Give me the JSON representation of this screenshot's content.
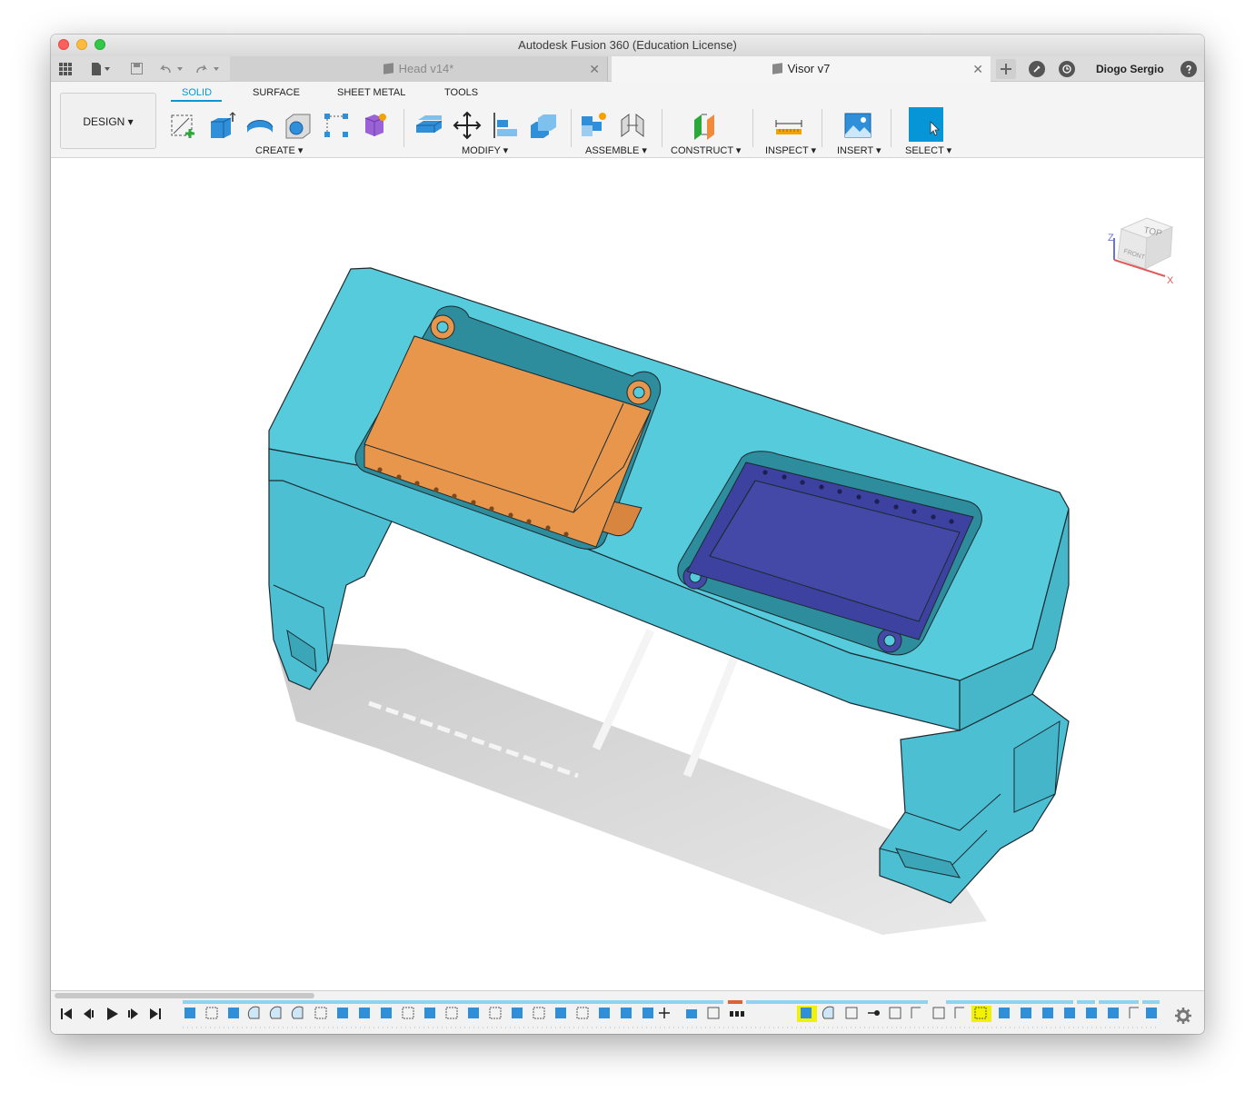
{
  "window": {
    "title": "Autodesk Fusion 360 (Education License)"
  },
  "tabs": [
    {
      "label": "Head v14*",
      "active": false
    },
    {
      "label": "Visor v7",
      "active": true
    }
  ],
  "tab_close_glyph": "✕",
  "user": {
    "name": "Diogo Sergio"
  },
  "design_menu": {
    "label": "DESIGN ▾"
  },
  "ribbon_tabs": [
    {
      "label": "SOLID",
      "active": true
    },
    {
      "label": "SURFACE",
      "active": false
    },
    {
      "label": "SHEET METAL",
      "active": false
    },
    {
      "label": "TOOLS",
      "active": false
    }
  ],
  "groups": {
    "create": "CREATE ▾",
    "modify": "MODIFY ▾",
    "assemble": "ASSEMBLE ▾",
    "construct": "CONSTRUCT ▾",
    "inspect": "INSPECT ▾",
    "insert": "INSERT ▾",
    "select": "SELECT ▾"
  },
  "viewcube": {
    "top": "TOP",
    "front": "FRONT",
    "axis_z": "Z",
    "axis_x": "X"
  },
  "colors": {
    "body": "#56cbdc",
    "body_dark": "#3fb0c2",
    "orange_part": "#e8964c",
    "purple_part": "#4449a8",
    "accent": "#0696d7",
    "highlight": "#f2f200"
  },
  "icons": {
    "apps": "grid-icon",
    "file": "file-icon",
    "save": "save-icon",
    "undo": "undo-icon",
    "redo": "redo-icon",
    "new_tab": "plus-icon",
    "jobs": "jobs-icon",
    "history": "clock-icon",
    "help": "help-icon",
    "settings": "gear-icon"
  }
}
